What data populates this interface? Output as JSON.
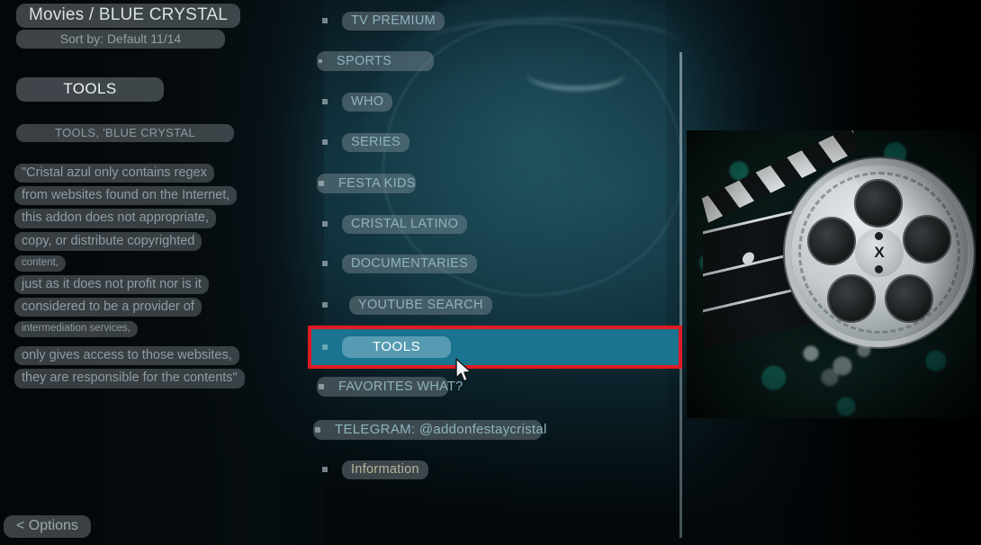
{
  "header": {
    "title": "Movies / BLUE CRYSTAL",
    "sort": "Sort by: Default 11/14"
  },
  "left_panel": {
    "section_title": "TOOLS",
    "section_subtitle": "TOOLS, 'BLUE CRYSTAL",
    "description_lines": [
      "\"Cristal azul only contains regex",
      "from websites found on the Internet,",
      "this addon does not appropriate,",
      "copy, or distribute copyrighted",
      "content,",
      "just as it does not profit nor is it",
      "considered to be a provider of",
      "intermediation services,",
      "only gives access to those websites,",
      "they are responsible for the contents\""
    ],
    "options_button": "< Options"
  },
  "menu": {
    "items": [
      {
        "label": "TV PREMIUM",
        "selected": false,
        "style": "normal"
      },
      {
        "label": "SPORTS",
        "selected": false,
        "style": "wide"
      },
      {
        "label": "WHO",
        "selected": false,
        "style": "normal"
      },
      {
        "label": "SERIES",
        "selected": false,
        "style": "normal"
      },
      {
        "label": "FESTA KIDS",
        "selected": false,
        "style": "wide"
      },
      {
        "label": "CRISTAL LATINO",
        "selected": false,
        "style": "normal"
      },
      {
        "label": "DOCUMENTARIES",
        "selected": false,
        "style": "normal"
      },
      {
        "label": "YOUTUBE SEARCH",
        "selected": false,
        "style": "normal"
      },
      {
        "label": "TOOLS",
        "selected": true,
        "style": "normal"
      },
      {
        "label": "FAVORITES WHAT?",
        "selected": false,
        "style": "wide"
      },
      {
        "label": "TELEGRAM: @addonfestaycristal",
        "selected": false,
        "style": "wide"
      },
      {
        "label": "Information",
        "selected": false,
        "style": "normal"
      }
    ]
  },
  "thumbnail": {
    "reel_hub_mark": "X"
  },
  "colors": {
    "selection_teal": "#1a7490",
    "annotation_red": "#e01b24",
    "label_text": "#8fb3bd",
    "title_text": "#d8e0e4"
  }
}
